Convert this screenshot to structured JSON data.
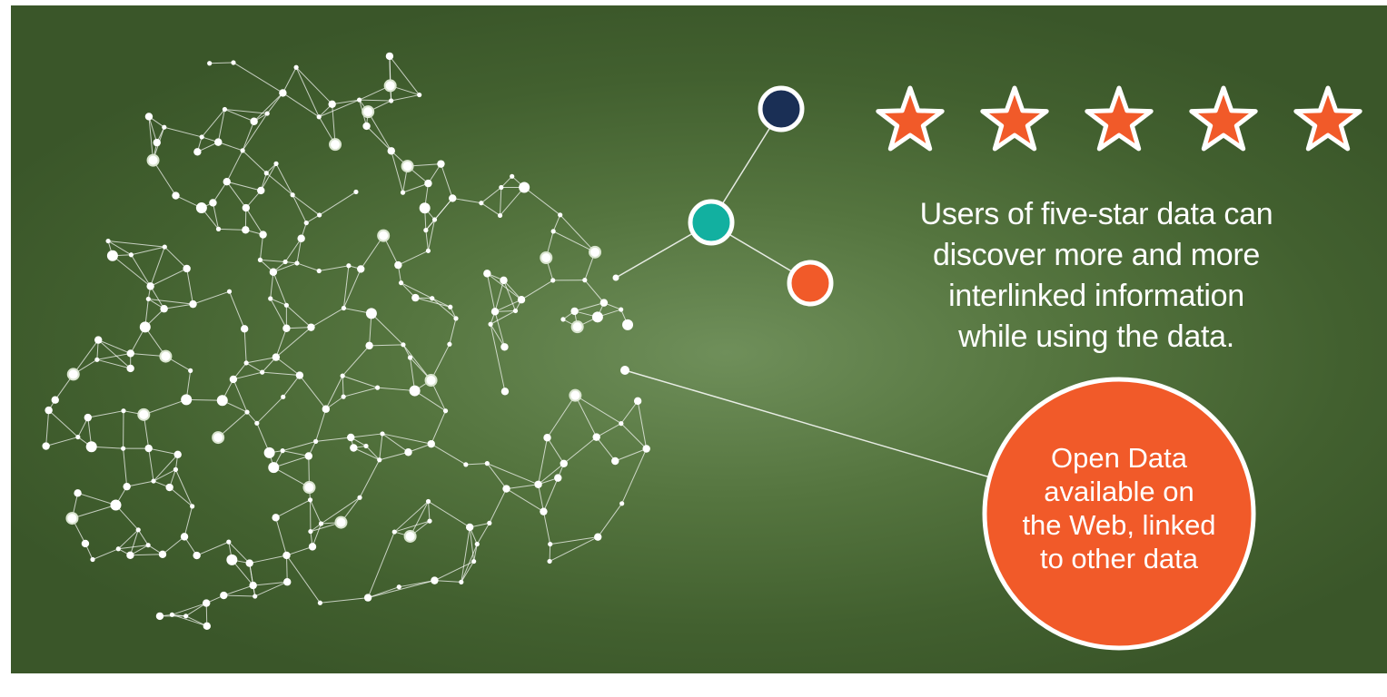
{
  "headline": {
    "line1": "Users of five-star data can",
    "line2": "discover more and more",
    "line3": "interlinked information",
    "line4": "while using the data."
  },
  "badge": {
    "line1": "Open Data",
    "line2": "available on",
    "line3": "the Web, linked",
    "line4": "to other data"
  },
  "rating": {
    "stars": 5,
    "max": 5
  },
  "colors": {
    "background": "#4a6a36",
    "accent_orange": "#f15a29",
    "navy": "#1a2f55",
    "teal": "#12b0a0",
    "node": "#ffffff"
  }
}
